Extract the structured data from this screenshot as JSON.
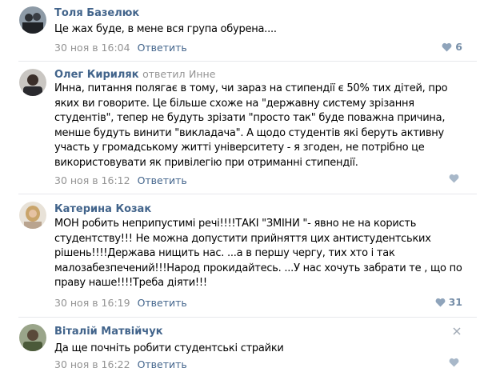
{
  "comments": [
    {
      "author": "Толя Базелюк",
      "reply_prefix": "",
      "reply_to": "",
      "text": "Це жах буде, в мене вся група обурена....",
      "date": "30 ноя в 16:04",
      "reply_label": "Ответить",
      "likes": "6",
      "avatar_icon": "user-avatar"
    },
    {
      "author": "Олег Кириляк",
      "reply_prefix": "ответил",
      "reply_to": "Инне",
      "text": "Инна, питання полягає в тому, чи зараз на стипендії є 50% тих дітей, про\nяких ви говорите. Це більше схоже на \"державну систему зрізання\nстудентів\", тепер не будуть зрізати \"просто так\" буде поважна причина,\nменше будуть винити \"викладача\". А щодо студентів які беруть активну\nучасть у громадському житті університету - я згоден, не потрібно це\nвикористовувати як привілегію при отриманні стипендії.",
      "date": "30 ноя в 16:12",
      "reply_label": "Ответить",
      "likes": "",
      "avatar_icon": "user-avatar"
    },
    {
      "author": "Катерина Козак",
      "reply_prefix": "",
      "reply_to": "",
      "text": "МОН робить неприпустимі речі!!!!ТАКІ \"ЗМІНИ \"- явно не на користь\nстудентству!!! Не можна допустити прийняття цих антистудентських\nрішень!!!!Держава нищить нас. ...а в першу чергу, тих хто і так\nмалозабезпечений!!!Народ прокидайтесь. ...У нас хочуть забрати те , що по\nправу наше!!!!Треба діяти!!!",
      "date": "30 ноя в 16:19",
      "reply_label": "Ответить",
      "likes": "31",
      "avatar_icon": "user-avatar"
    },
    {
      "author": "Віталій Матвійчук",
      "reply_prefix": "",
      "reply_to": "",
      "text": "Да ще почніть робити студентські страйки",
      "date": "30 ноя в 16:22",
      "reply_label": "Ответить",
      "likes": "",
      "avatar_icon": "user-avatar"
    }
  ],
  "colors": {
    "link": "#42648b",
    "meta": "#939393",
    "like": "#768ea8",
    "divider": "#e7e8ec"
  },
  "icons": {
    "like": "heart-icon",
    "close": "close-icon"
  }
}
